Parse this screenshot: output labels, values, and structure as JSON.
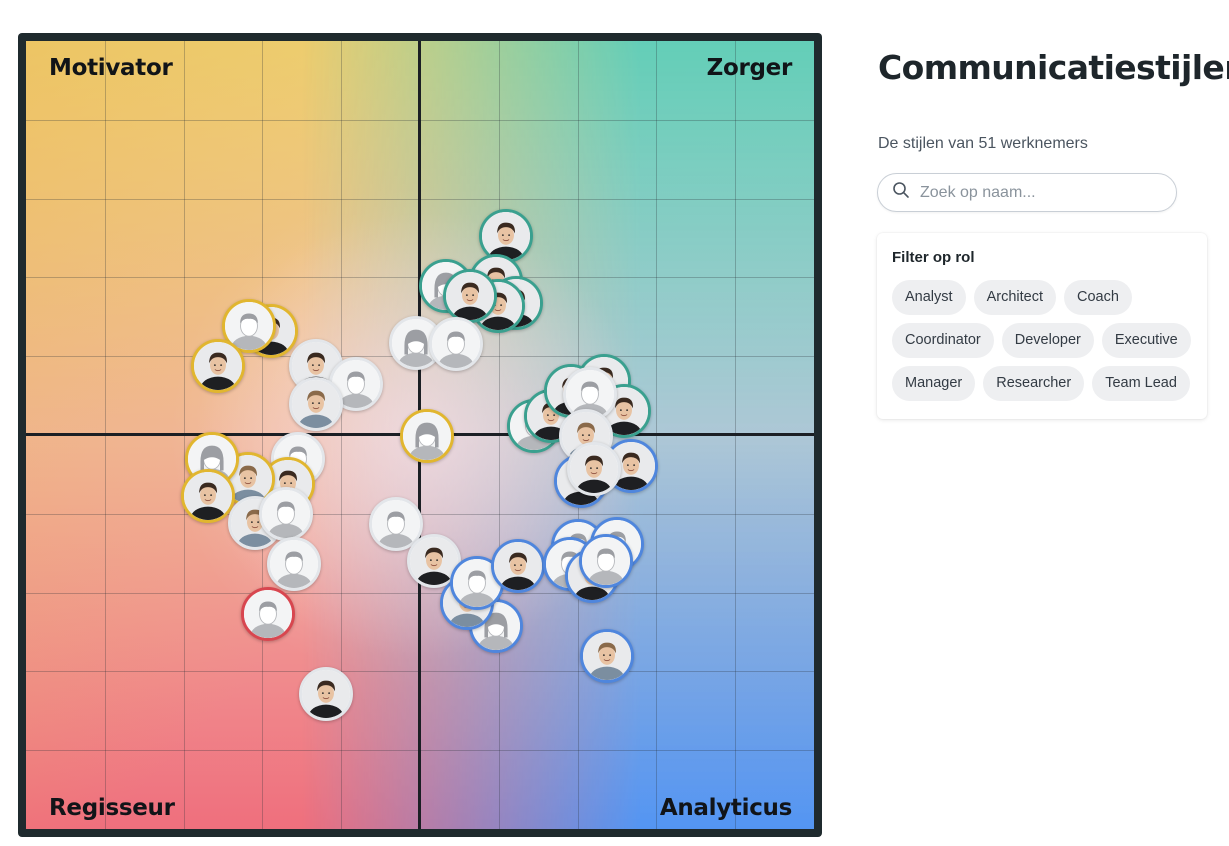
{
  "chart": {
    "quadrants": {
      "top_left": "Motivator",
      "top_right": "Zorger",
      "bottom_left": "Regisseur",
      "bottom_right": "Analyticus"
    },
    "colors": {
      "motivator": "#eedc83",
      "zorger": "#5ccdbb",
      "regisseur": "#ef6f7d",
      "analyticus": "#5096f5",
      "ring_yellow": "#e1b62f",
      "ring_teal": "#3aa08f",
      "ring_blue": "#4f86dd",
      "ring_red": "#d8464f"
    }
  },
  "sidebar": {
    "title": "Communicatiestijlen",
    "subtitle": "De stijlen van 51 werknemers",
    "search_placeholder": "Zoek op naam...",
    "filter_title": "Filter op rol",
    "roles": [
      "Analyst",
      "Architect",
      "Coach",
      "Coordinator",
      "Developer",
      "Executive",
      "Manager",
      "Researcher",
      "Team Lead"
    ]
  },
  "icons": {
    "search": "search-icon",
    "placeholder_male": "person-placeholder-icon",
    "placeholder_female": "person-placeholder-female-icon"
  }
}
